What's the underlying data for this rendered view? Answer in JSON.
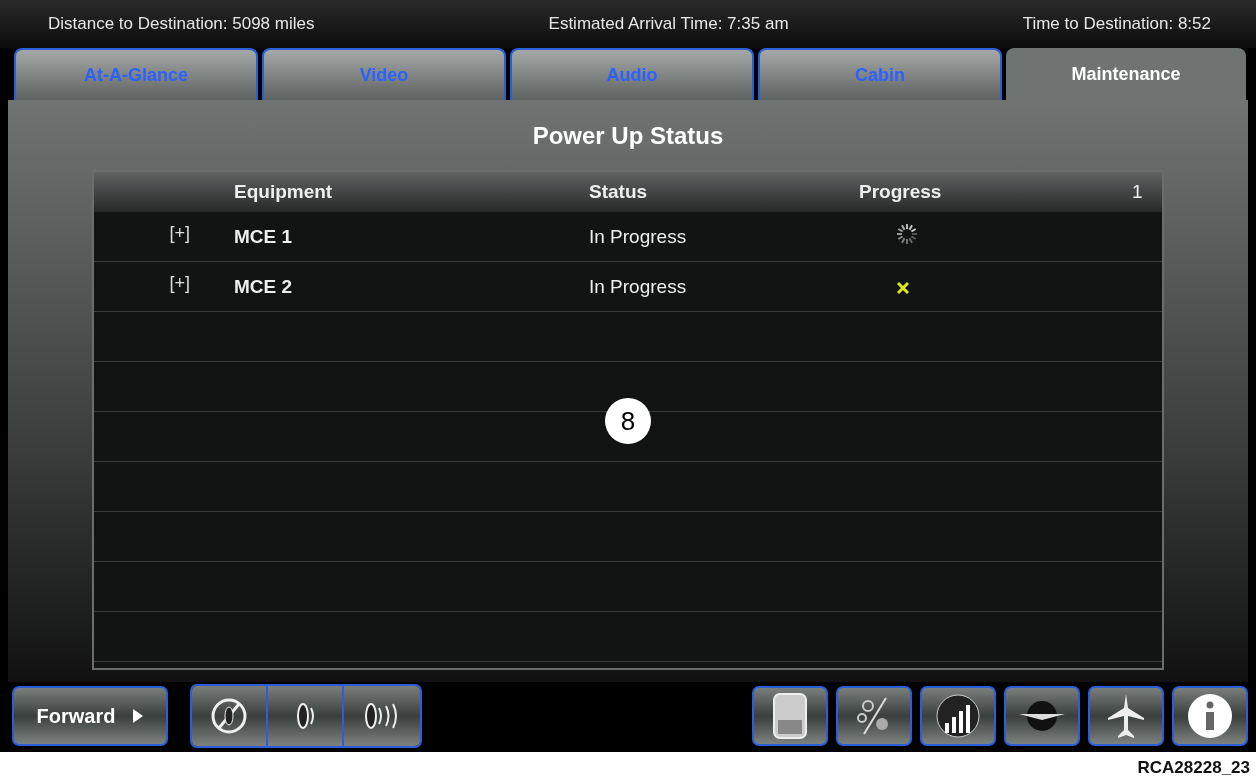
{
  "status_bar": {
    "distance": "Distance to Destination: 5098 miles",
    "arrival": "Estimated Arrival Time: 7:35 am",
    "time_left": "Time to Destination: 8:52"
  },
  "tabs": [
    {
      "label": "At-A-Glance",
      "selected": false
    },
    {
      "label": "Video",
      "selected": false
    },
    {
      "label": "Audio",
      "selected": false
    },
    {
      "label": "Cabin",
      "selected": false
    },
    {
      "label": "Maintenance",
      "selected": true
    }
  ],
  "panel": {
    "title": "Power Up Status",
    "table": {
      "columns": [
        "Equipment",
        "Status",
        "Progress"
      ],
      "page": "1",
      "rows": [
        {
          "expander": "[+]",
          "equipment": "MCE 1",
          "status": "In Progress",
          "progress": {
            "kind": "spinner"
          }
        },
        {
          "expander": "[+]",
          "equipment": "MCE 2",
          "status": "In Progress",
          "progress": {
            "kind": "failed"
          }
        }
      ]
    }
  },
  "callout": "8",
  "forward_button": {
    "label": "Forward"
  },
  "figure_id": "RCA28228_23"
}
